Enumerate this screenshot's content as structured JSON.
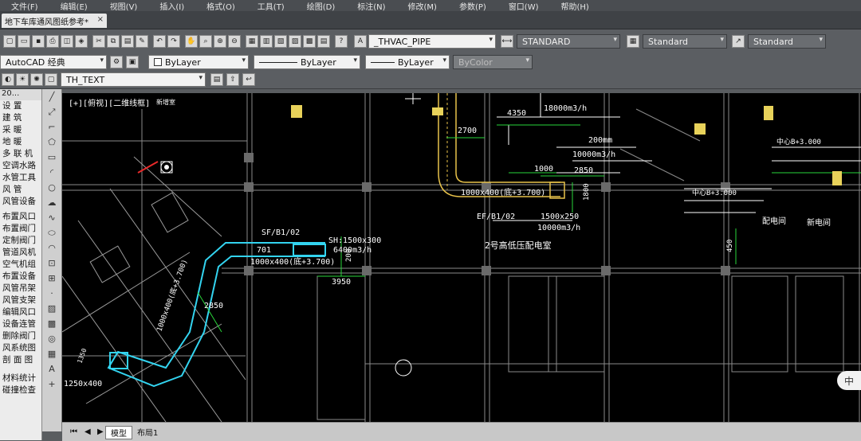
{
  "menu": [
    "文件(F)",
    "编辑(E)",
    "视图(V)",
    "插入(I)",
    "格式(O)",
    "工具(T)",
    "绘图(D)",
    "标注(N)",
    "修改(M)",
    "参数(P)",
    "窗口(W)",
    "帮助(H)"
  ],
  "document_tab": {
    "title": "地下车库通风图纸参考*"
  },
  "toolbar": {
    "text_style": "_THVAC_PIPE",
    "dim_style": "STANDARD",
    "table_style": "Standard",
    "multileader_style": "Standard",
    "workspace": "AutoCAD 经典",
    "color": "ByLayer",
    "linetype": "ByLayer",
    "lineweight": "ByLayer",
    "plotstyle": "ByColor",
    "layer": "TH_TEXT"
  },
  "left_panel": {
    "header": "20...",
    "items": [
      "设 置",
      "建 筑",
      "采 暖",
      "地 暖",
      "多 联 机",
      "空调水路",
      "水管工具",
      "风 管",
      "风管设备",
      "布置风口",
      "布置阀门",
      "定制阀门",
      "管道风机",
      "空气机组",
      "布置设备",
      "风管吊架",
      "风管支架",
      "编辑风口",
      "设备连管",
      "删除阀门",
      "风系统图",
      "剖 面 图",
      "材料统计",
      "碰撞检查"
    ]
  },
  "canvas": {
    "viewport_label": "[+][俯视][二维线框]",
    "labels": {
      "room_top_left": "新增室",
      "dim_4350": "4350",
      "dim_2700": "2700",
      "dim_2850_top": "2850",
      "dim_1000": "1000",
      "dim_1800": "1800",
      "duct_top": "1000x400(底+3.700)",
      "fan_ef": "EF/B1/02",
      "duct_ef": "1500x250",
      "flow_ef": "10000m3/h",
      "duct_200mm": "200mm",
      "flow_top": "18000m3/h",
      "flow_top2": "10000m3/h",
      "fan_sf": "SF/B1/02",
      "duct_sf": "SH:1500x300",
      "flow_sf": "6400m3/h",
      "duct_sf2": "1000x400(底+3.700)",
      "dim_701": "701",
      "dim_200": "200",
      "dim_3950": "3950",
      "dim_2850_left": "2850",
      "duct_diag": "1000x400(底+3.700)",
      "dim_1350": "1350",
      "duct_bottom_left": "1250x400",
      "room_substation": "2号高低压配电室",
      "room_dist1": "配电间",
      "room_dist2": "新电间",
      "dim_450": "450",
      "elev_b": "中心B+3.000",
      "elev_c": "中心B+3.000"
    }
  },
  "status": {
    "model_tab": "模型",
    "layout_tab": "布局1"
  },
  "ime": "中"
}
